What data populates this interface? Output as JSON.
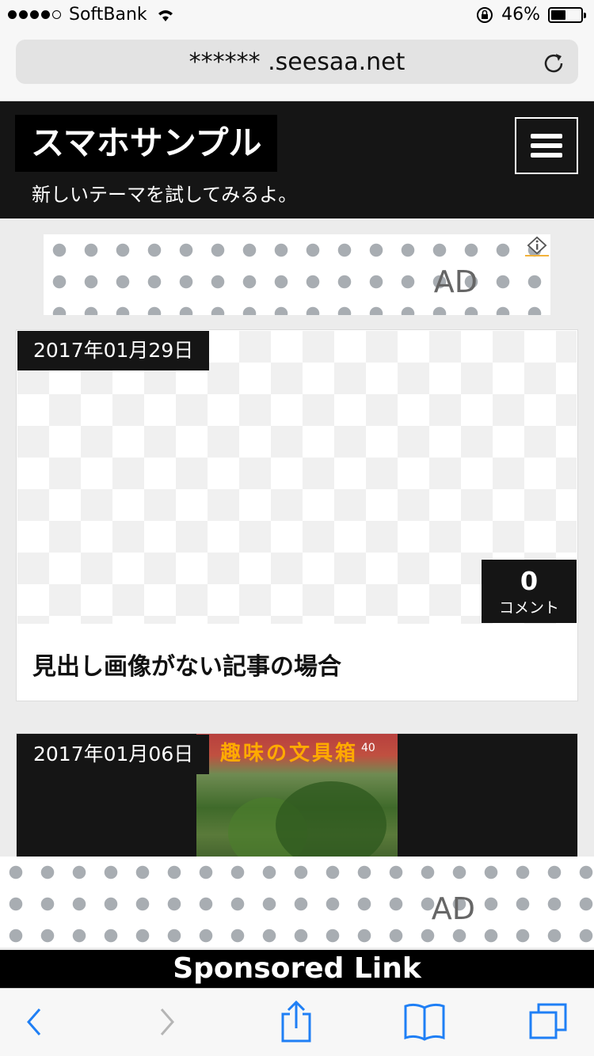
{
  "status_bar": {
    "carrier": "SoftBank",
    "battery_percent": "46%",
    "signal_bars": 4
  },
  "browser": {
    "url": "****** .seesaa.net"
  },
  "site": {
    "title": "スマホサンプル",
    "tagline": "新しいテーマを試してみるよ。"
  },
  "ads": {
    "top_label": "AD",
    "bottom_label": "AD"
  },
  "posts": [
    {
      "date": "2017年01月29日",
      "comment_count": "0",
      "comment_label": "コメント",
      "title": "見出し画像がない記事の場合"
    },
    {
      "date": "2017年01月06日",
      "thumb_text": "趣味の文具箱",
      "thumb_issue": "40"
    }
  ],
  "sponsored_label": "Sponsored Link",
  "colors": {
    "header_bg": "#151515",
    "page_bg": "#ececec",
    "ios_blue": "#1f7ff5"
  }
}
